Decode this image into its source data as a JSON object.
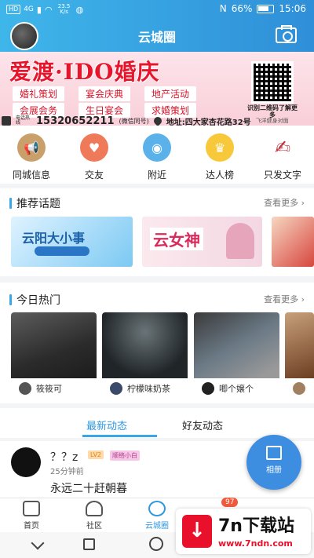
{
  "status": {
    "hd": "HD",
    "net": "4G",
    "speed": "23.5 K/s",
    "battery": "66%",
    "time": "15:06"
  },
  "header": {
    "title": "云城圈"
  },
  "banner": {
    "headline": "爱渡·IDO婚庆",
    "services": [
      "婚礼策划",
      "宴会庆典",
      "地产活动",
      "会展会务",
      "生日宴会",
      "求婚策划"
    ],
    "phone_label": "电话热线",
    "phone": "15320652211",
    "phone_note": "(微信同号)",
    "address": "地址:四大家杏花路32号",
    "address_note": "飞洋健身对面",
    "qr_caption": "识别二维码了解更多"
  },
  "categories": [
    {
      "label": "同城信息",
      "icon": "megaphone-icon",
      "color": "#c9a06a"
    },
    {
      "label": "交友",
      "icon": "heartbeat-icon",
      "color": "#ef7a5a"
    },
    {
      "label": "附近",
      "icon": "location-target-icon",
      "color": "#5bb2ea"
    },
    {
      "label": "达人榜",
      "icon": "crown-icon",
      "color": "#f6c83a"
    },
    {
      "label": "只发文字",
      "icon": "pen-hand-icon",
      "color": "#c22d3a"
    }
  ],
  "topics": {
    "title": "推荐话题",
    "more": "查看更多",
    "items": [
      "云阳大小事",
      "云女神"
    ]
  },
  "hot": {
    "title": "今日热门",
    "more": "查看更多",
    "items": [
      {
        "user": "筱筱可"
      },
      {
        "user": "柠檬味奶茶"
      },
      {
        "user": "唧个嬢个"
      }
    ]
  },
  "tabs": {
    "latest": "最新动态",
    "friends": "好友动态"
  },
  "post": {
    "name": "？？z",
    "tag1": "LV2",
    "tag2": "顺络小白",
    "time": "25分钟前",
    "content": "永远二十赶朝暮"
  },
  "fab": {
    "label": "相册"
  },
  "bottom_nav": {
    "home": "首页",
    "community": "社区",
    "circle": "云城圈",
    "badge": "97"
  },
  "watermark": {
    "brand": "7n下载站",
    "url": "www.7ndn.com"
  }
}
